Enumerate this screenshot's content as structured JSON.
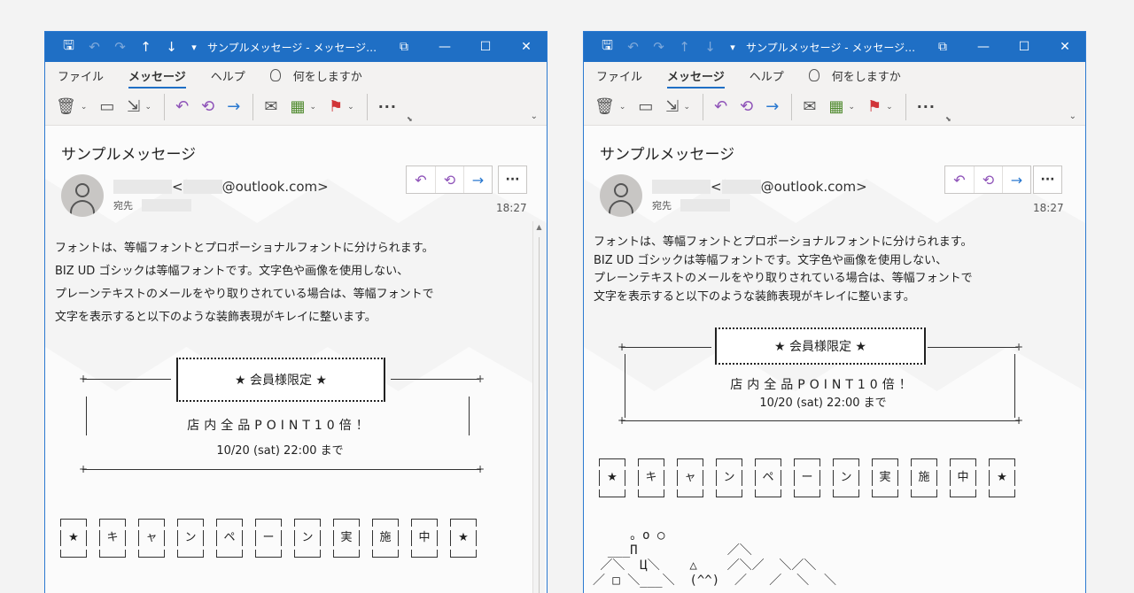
{
  "window": {
    "title": "サンプルメッセージ - メッセージ…",
    "menu": [
      "ファイル",
      "メッセージ",
      "ヘルプ"
    ],
    "tell_me": "何をしますか"
  },
  "message": {
    "subject": "サンプルメッセージ",
    "sender_left": "<",
    "sender_domain": "@outlook.com>",
    "to_label": "宛先",
    "time": "18:27"
  },
  "body": {
    "lines": [
      "フォントは、等幅フォントとプロポーショナルフォントに分けられます。",
      "BIZ UD ゴシックは等幅フォントです。文字色や画像を使用しない、",
      "プレーンテキストのメールをやり取りされている場合は、等幅フォントで",
      "文字を表示すると以下のような装飾表現がキレイに整います。"
    ],
    "banner": "★ 会員様限定 ★",
    "shop_line": "店内全品POINT10倍！",
    "date_line": "10/20 (sat) 22:00 まで",
    "campaign_chars": [
      "★",
      "キ",
      "ャ",
      "ン",
      "ペ",
      "ー",
      "ン",
      "実",
      "施",
      "中",
      "★"
    ],
    "ascii_art": "     。o ○\n  ___Π            ／＼\n ／＼  Ц＼    △    ／＼／  ＼／＼\n／ □ ＼___＼  (^^)  ／   ／  ＼  ＼"
  },
  "colors": {
    "titlebar": "#1f6fc5",
    "accent_purple": "#8e52b8",
    "accent_blue": "#2b79d0",
    "flag_red": "#d13438"
  },
  "icons": [
    "save-icon",
    "undo-icon",
    "redo-icon",
    "up-arrow-icon",
    "down-arrow-icon",
    "customize-icon",
    "restore-icon",
    "minimize-icon",
    "maximize-icon",
    "close-icon",
    "delete-icon",
    "archive-icon",
    "move-icon",
    "reply-icon",
    "reply-all-icon",
    "forward-icon",
    "mail-icon",
    "categorize-icon",
    "flag-icon",
    "more-icon",
    "person-icon"
  ]
}
